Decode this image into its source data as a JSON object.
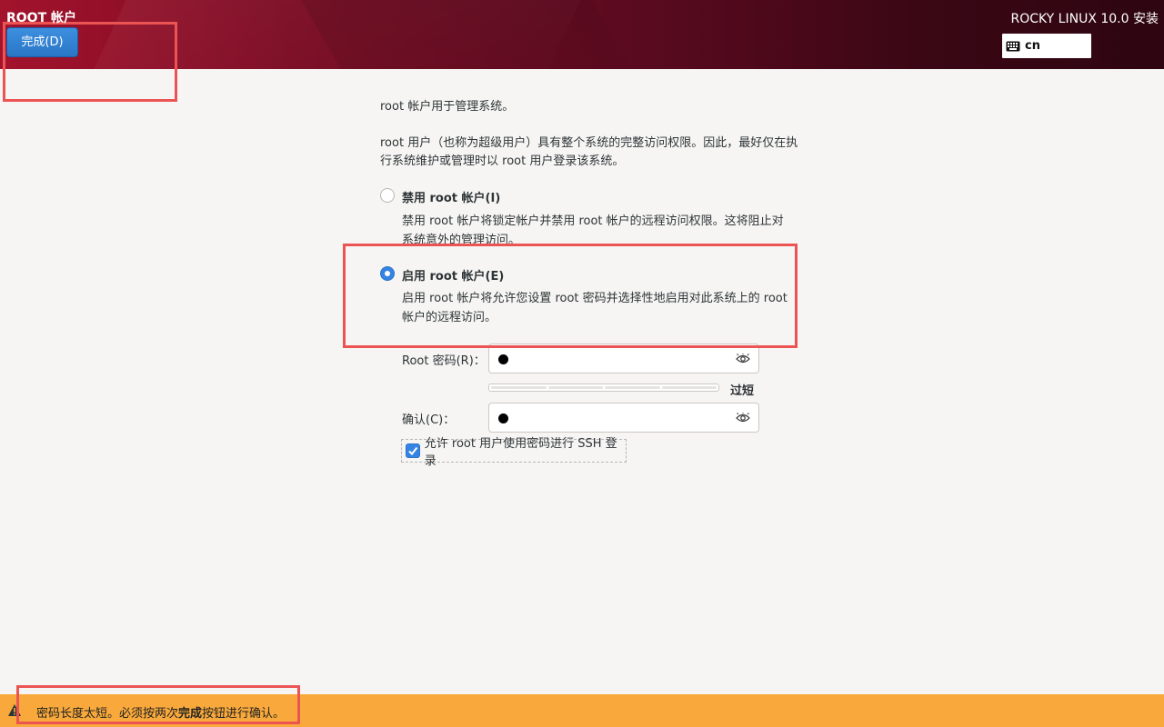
{
  "header": {
    "page_title": "ROOT 帐户",
    "done_button": "完成(D)",
    "product_title": "ROCKY LINUX 10.0 安装",
    "keyboard_layout": "cn",
    "gradient_colors": [
      "#a3132c",
      "#2e0511"
    ]
  },
  "intro": {
    "line1": "root 帐户用于管理系统。",
    "line2": "root 用户（也称为超级用户）具有整个系统的完整访问权限。因此，最好仅在执行系统维护或管理时以 root 用户登录该系统。"
  },
  "options": {
    "disable": {
      "label": "禁用 root 帐户(I)",
      "description": "禁用 root 帐户将锁定帐户并禁用 root 帐户的远程访问权限。这将阻止对系统意外的管理访问。",
      "selected": false
    },
    "enable": {
      "label": "启用 root 帐户(E)",
      "description": "启用 root 帐户将允许您设置 root 密码并选择性地启用对此系统上的 root 帐户的远程访问。",
      "selected": true
    }
  },
  "password": {
    "label": "Root 密码(R)：",
    "strength_label": "过短",
    "strength_level": 0
  },
  "confirm": {
    "label": "确认(C)："
  },
  "ssh": {
    "label": "允许 root 用户使用密码进行 SSH 登录",
    "checked": true
  },
  "warning": {
    "prefix": "密码长度太短。必须按两次",
    "bold": "完成",
    "suffix": "按钮进行确认。",
    "color": "#f9a93b"
  },
  "accent_color": "#3584e4",
  "highlight_color": "#ec5454"
}
